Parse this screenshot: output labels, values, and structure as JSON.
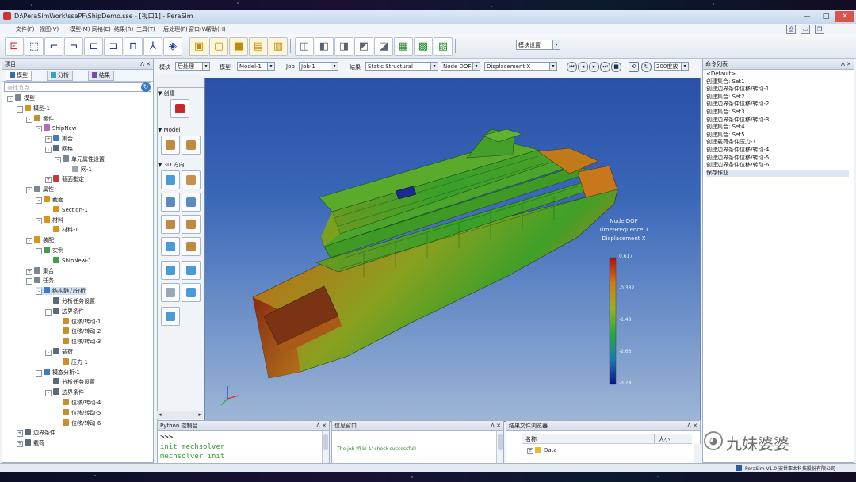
{
  "window": {
    "title": "D:\\PeraSimWork\\ssePF\\ShipDemo.sse - [视口1] - PeraSim",
    "minimize": "—",
    "maximize": "□",
    "close": "✕"
  },
  "menu": {
    "items": [
      "文件(F)",
      "视图(V)",
      "模型(M)",
      "网格(E)",
      "结果(R)",
      "工具(T)",
      "后处理(P)",
      "窗口(W)",
      "帮助(H)"
    ],
    "right_icons": [
      "printer-icon",
      "save-icon",
      "restore-icon"
    ]
  },
  "toolbar": {
    "group1": [
      {
        "name": "reset-view-icon",
        "glyph": "⊡",
        "tone": "red"
      },
      {
        "name": "fit-view-icon",
        "glyph": "⬚",
        "tone": "blue"
      },
      {
        "name": "view-front-icon",
        "glyph": "⌐",
        "tone": "blue"
      },
      {
        "name": "view-back-icon",
        "glyph": "¬",
        "tone": "blue"
      },
      {
        "name": "view-left-icon",
        "glyph": "⊏",
        "tone": "blue"
      },
      {
        "name": "view-right-icon",
        "glyph": "⊐",
        "tone": "blue"
      },
      {
        "name": "view-top-icon",
        "glyph": "⊓",
        "tone": "blue"
      },
      {
        "name": "axis-triad-icon",
        "glyph": "⅄",
        "tone": "blue"
      },
      {
        "name": "iso-view-icon",
        "glyph": "◈",
        "tone": "blue"
      }
    ],
    "group2": [
      {
        "name": "shaded-cube-icon",
        "glyph": "▣",
        "tone": "gold"
      },
      {
        "name": "wire-cube-icon",
        "glyph": "▢",
        "tone": "gold"
      },
      {
        "name": "solid-cube-icon",
        "glyph": "■",
        "tone": "gold"
      },
      {
        "name": "edge-cube-icon",
        "glyph": "▤",
        "tone": "gold"
      },
      {
        "name": "hidden-cube-icon",
        "glyph": "▥",
        "tone": "gold"
      }
    ],
    "group3": [
      {
        "name": "mesh-display-icon",
        "glyph": "◫",
        "tone": "gray"
      },
      {
        "name": "mesh-edge-icon",
        "glyph": "◧",
        "tone": "gray"
      },
      {
        "name": "mesh-free-icon",
        "glyph": "◨",
        "tone": "gray"
      },
      {
        "name": "mesh-feature-icon",
        "glyph": "◩",
        "tone": "gray"
      },
      {
        "name": "mesh-shrink-icon",
        "glyph": "◪",
        "tone": "gray"
      },
      {
        "name": "element-shaded-icon",
        "glyph": "▦",
        "tone": "green"
      },
      {
        "name": "element-wire-icon",
        "glyph": "▩",
        "tone": "green"
      },
      {
        "name": "element-solid-icon",
        "glyph": "▧",
        "tone": "green"
      }
    ],
    "mode_combo": "模块设置"
  },
  "model_tree": {
    "title": "项目",
    "tabs": [
      "模型",
      "分析",
      "结果"
    ],
    "search_placeholder": "查找节点",
    "items": [
      {
        "label": "模型",
        "depth": 0,
        "exp": "-",
        "color": "#7b8794"
      },
      {
        "label": "模型-1",
        "depth": 1,
        "exp": "-",
        "color": "#d7941a"
      },
      {
        "label": "零件",
        "depth": 2,
        "exp": "-",
        "color": "#c6902a"
      },
      {
        "label": "ShipNew",
        "depth": 3,
        "exp": "-",
        "color": "#b46ab8"
      },
      {
        "label": "集合",
        "depth": 4,
        "exp": "+",
        "color": "#3f79c4"
      },
      {
        "label": "网格",
        "depth": 4,
        "exp": "-",
        "color": "#5a6a7a"
      },
      {
        "label": "单元属性设置",
        "depth": 5,
        "exp": "-",
        "color": "#7b8794"
      },
      {
        "label": "网-1",
        "depth": 6,
        "exp": "",
        "color": "#9aa6b2"
      },
      {
        "label": "截面指定",
        "depth": 4,
        "exp": "+",
        "color": "#c43a3a"
      },
      {
        "label": "属性",
        "depth": 2,
        "exp": "-",
        "color": "#7b8794"
      },
      {
        "label": "截面",
        "depth": 3,
        "exp": "-",
        "color": "#d7941a"
      },
      {
        "label": "Section-1",
        "depth": 4,
        "exp": "",
        "color": "#d7941a"
      },
      {
        "label": "材料",
        "depth": 3,
        "exp": "-",
        "color": "#d7941a"
      },
      {
        "label": "材料-1",
        "depth": 4,
        "exp": "",
        "color": "#d7941a"
      },
      {
        "label": "装配",
        "depth": 2,
        "exp": "-",
        "color": "#d7941a"
      },
      {
        "label": "实例",
        "depth": 3,
        "exp": "-",
        "color": "#3ea04a"
      },
      {
        "label": "ShipNew-1",
        "depth": 4,
        "exp": "",
        "color": "#3ea04a"
      },
      {
        "label": "集合",
        "depth": 2,
        "exp": "+",
        "color": "#7b8794"
      },
      {
        "label": "任务",
        "depth": 2,
        "exp": "-",
        "color": "#7b8794"
      },
      {
        "label": "结构静力分析",
        "depth": 3,
        "exp": "-",
        "color": "#3f79c4",
        "selected": true
      },
      {
        "label": "分析任务设置",
        "depth": 4,
        "exp": "",
        "color": "#5a6a7a"
      },
      {
        "label": "边界条件",
        "depth": 4,
        "exp": "-",
        "color": "#5a6a7a"
      },
      {
        "label": "位移/转动-1",
        "depth": 5,
        "exp": "",
        "color": "#c6902a"
      },
      {
        "label": "位移/转动-2",
        "depth": 5,
        "exp": "",
        "color": "#c6902a"
      },
      {
        "label": "位移/转动-3",
        "depth": 5,
        "exp": "",
        "color": "#c6902a"
      },
      {
        "label": "载荷",
        "depth": 4,
        "exp": "-",
        "color": "#5a6a7a"
      },
      {
        "label": "压力-1",
        "depth": 5,
        "exp": "",
        "color": "#c6902a"
      },
      {
        "label": "模态分析-1",
        "depth": 3,
        "exp": "-",
        "color": "#3f79c4"
      },
      {
        "label": "分析任务设置",
        "depth": 4,
        "exp": "",
        "color": "#5a6a7a"
      },
      {
        "label": "边界条件",
        "depth": 4,
        "exp": "-",
        "color": "#5a6a7a"
      },
      {
        "label": "位移/转动-4",
        "depth": 5,
        "exp": "",
        "color": "#c6902a"
      },
      {
        "label": "位移/转动-5",
        "depth": 5,
        "exp": "",
        "color": "#c6902a"
      },
      {
        "label": "位移/转动-6",
        "depth": 5,
        "exp": "",
        "color": "#c6902a"
      },
      {
        "label": "边界条件",
        "depth": 1,
        "exp": "+",
        "color": "#5a6a7a"
      },
      {
        "label": "载荷",
        "depth": 1,
        "exp": "+",
        "color": "#5a6a7a"
      }
    ]
  },
  "stepbar": {
    "module_label": "模块",
    "module_value": "后处理",
    "model_label": "模型",
    "model_value": "Model-1",
    "job_label": "Job",
    "job_value": "Job-1",
    "result_label": "结果",
    "result_value": "Static Structural",
    "field_value": "Node DOF",
    "comp_value": "Displacement X",
    "zoom_value": "200度放"
  },
  "palette": {
    "section1": "▼ 创建",
    "section2": "▼ Model",
    "section3": "▼ 3D 方向"
  },
  "viewport": {
    "legend": {
      "line1": "Node DOF",
      "line2": "Time/Frequence:1",
      "line3": "Displacement X",
      "ticks": [
        "0.617",
        "-0.332",
        "-1.48",
        "-2.63",
        "-3.78"
      ]
    },
    "colors": {
      "hull_green": "#35a02a",
      "hull_yellow": "#b9a220",
      "hull_red": "#a5401a",
      "sky_top": "#2a50a8"
    }
  },
  "python_panel": {
    "title": "Python 控制台",
    "lines": [
      ">>>",
      "init mechsolver",
      "mechsolver init"
    ]
  },
  "info_panel": {
    "title": "信息窗口",
    "message": "The job '作业-1' check successful!"
  },
  "file_panel": {
    "title": "结果文件浏览器",
    "col_name": "名称",
    "col_size": "大小",
    "row": "Data"
  },
  "command_panel": {
    "title": "命令列表",
    "items": [
      "<Default>",
      "创建集合: Set1",
      "创建边界条件位移/转动-1",
      "创建集合: Set2",
      "创建边界条件位移/转动-2",
      "创建集合: Set3",
      "创建边界条件位移/转动-3",
      "创建集合: Set4",
      "创建集合: Set5",
      "创建载荷条件压力-1",
      "创建边界条件位移/转动-4",
      "创建边界条件位移/转动-5",
      "创建边界条件位移/转动-6",
      "保存作业..."
    ]
  },
  "status": {
    "text": "PeraSim V1.0 安世亚太科技股份有限公司"
  },
  "watermark": {
    "text": "九妹婆婆"
  }
}
